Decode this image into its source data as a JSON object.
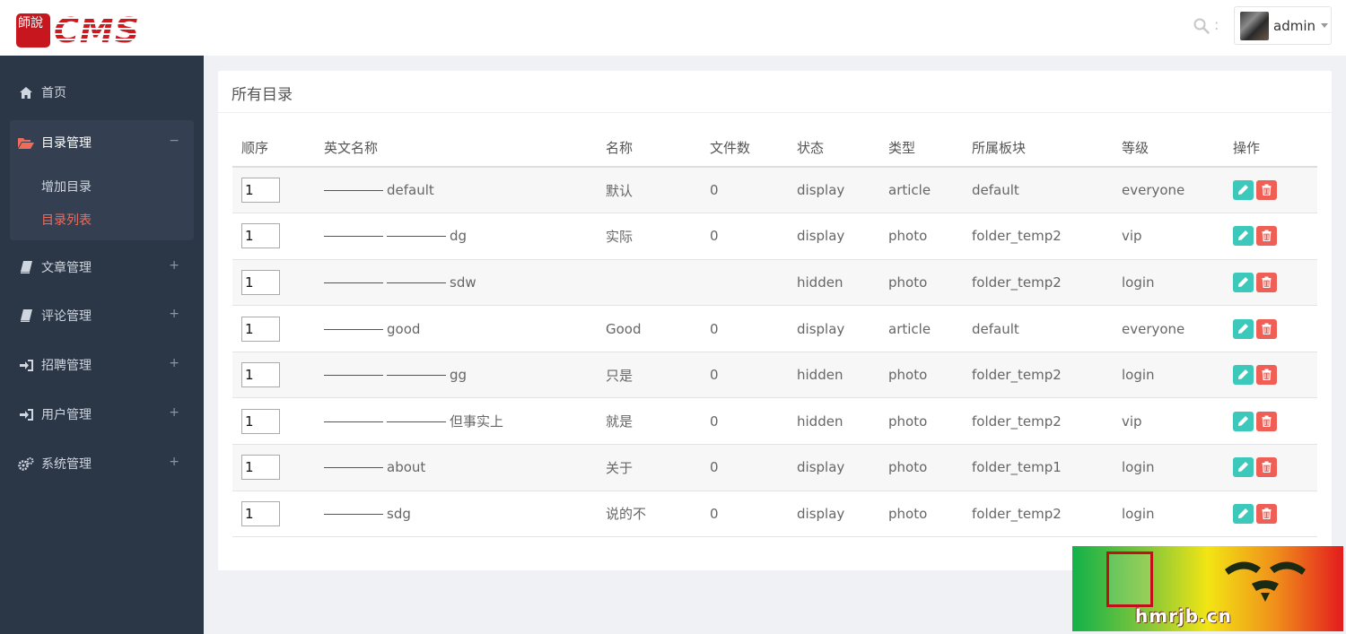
{
  "header": {
    "logo_seal_text": "師說",
    "logo_text": "CMS",
    "search_separator": ":",
    "user_name": "admin"
  },
  "sidebar": {
    "items": [
      {
        "label": "首页",
        "icon": "home-icon"
      },
      {
        "label": "目录管理",
        "icon": "folder-open-icon",
        "toggle": "−"
      },
      {
        "label": "文章管理",
        "icon": "book-icon",
        "toggle": "+"
      },
      {
        "label": "评论管理",
        "icon": "book-icon",
        "toggle": "+"
      },
      {
        "label": "招聘管理",
        "icon": "sign-in-icon",
        "toggle": "+"
      },
      {
        "label": "用户管理",
        "icon": "sign-in-icon",
        "toggle": "+"
      },
      {
        "label": "系统管理",
        "icon": "gears-icon",
        "toggle": "+"
      }
    ],
    "sub_items": [
      {
        "label": "增加目录"
      },
      {
        "label": "目录列表"
      }
    ]
  },
  "panel": {
    "title": "所有目录",
    "columns": [
      "顺序",
      "英文名称",
      "名称",
      "文件数",
      "状态",
      "类型",
      "所属板块",
      "等级",
      "操作"
    ],
    "rows": [
      {
        "order": "1",
        "english_name": "default",
        "name": "默认",
        "file_count": "0",
        "status": "display",
        "type": "article",
        "section": "default",
        "level": "everyone"
      },
      {
        "order": "1",
        "english_name": "dg",
        "name": "实际",
        "file_count": "0",
        "status": "display",
        "type": "photo",
        "section": "folder_temp2",
        "level": "vip"
      },
      {
        "order": "1",
        "english_name": "sdw",
        "name": "",
        "file_count": "",
        "status": "hidden",
        "type": "photo",
        "section": "folder_temp2",
        "level": "login"
      },
      {
        "order": "1",
        "english_name": "good",
        "name": "Good",
        "file_count": "0",
        "status": "display",
        "type": "article",
        "section": "default",
        "level": "everyone"
      },
      {
        "order": "1",
        "english_name": "gg",
        "name": "只是",
        "file_count": "0",
        "status": "hidden",
        "type": "photo",
        "section": "folder_temp2",
        "level": "login"
      },
      {
        "order": "1",
        "english_name": "但事实上",
        "name": "就是",
        "file_count": "0",
        "status": "hidden",
        "type": "photo",
        "section": "folder_temp2",
        "level": "vip"
      },
      {
        "order": "1",
        "english_name": "about",
        "name": "关于",
        "file_count": "0",
        "status": "display",
        "type": "photo",
        "section": "folder_temp1",
        "level": "login"
      },
      {
        "order": "1",
        "english_name": "sdg",
        "name": "说的不",
        "file_count": "0",
        "status": "display",
        "type": "photo",
        "section": "folder_temp2",
        "level": "login"
      }
    ]
  },
  "watermark": {
    "text": "hmrjb.cn"
  },
  "colors": {
    "sidebar_bg": "#2b3647",
    "accent_active": "#ef6c5b",
    "edit_button": "#3cc8bb",
    "delete_button": "#ef5f55"
  }
}
